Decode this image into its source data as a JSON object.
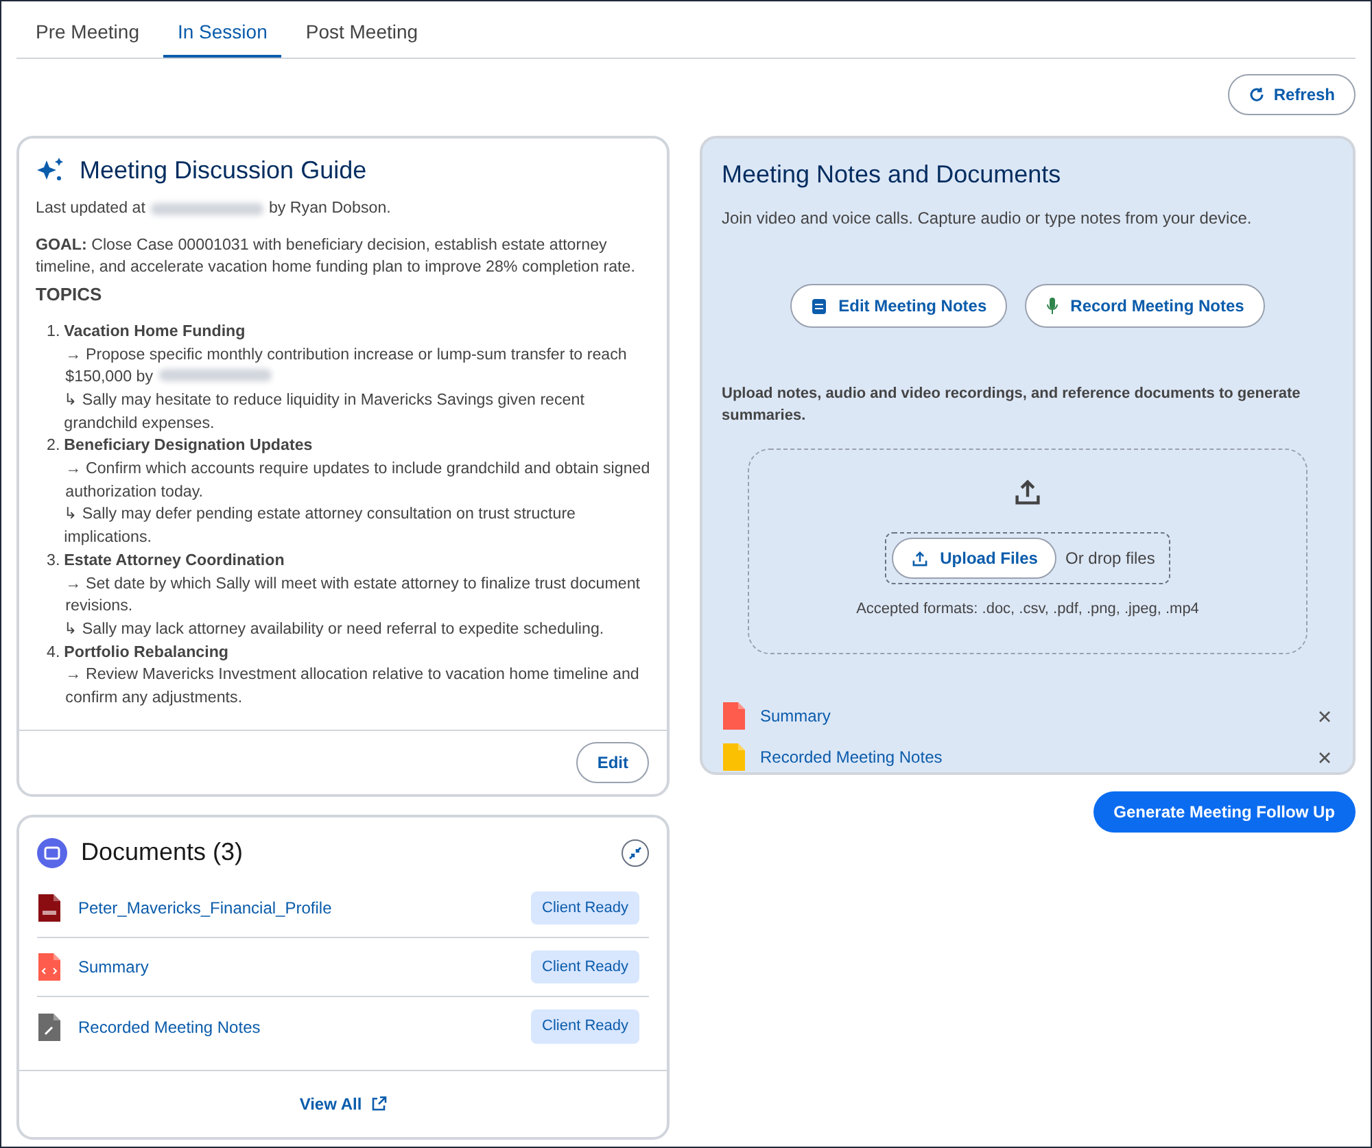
{
  "tabs": [
    {
      "label": "Pre Meeting",
      "selected": false
    },
    {
      "label": "In Session",
      "selected": true
    },
    {
      "label": "Post Meeting",
      "selected": false
    }
  ],
  "refresh_button": {
    "label": "Refresh"
  },
  "discussion_guide": {
    "title": "Meeting Discussion Guide",
    "updated_prefix": "Last updated at",
    "updated_suffix": "by Ryan Dobson.",
    "goal": "**GOAL:** Close Case 00001031 with beneficiary decision, establish estate attorney timeline, and accelerate vacation home funding plan to improve 28% completion rate.",
    "topics_heading": "TOPICS",
    "topics": [
      {
        "number": "1.",
        "title": "Vacation Home Funding",
        "action": "→ Propose specific monthly contribution increase or lump-sum transfer to reach $150,000 by",
        "action_redacted": true,
        "risk": "↳ Sally may hesitate to reduce liquidity in Mavericks Savings given recent grandchild expenses."
      },
      {
        "number": "2.",
        "title": "Beneficiary Designation Updates",
        "action": "→ Confirm which accounts require updates to include grandchild and obtain signed authorization today.",
        "action_redacted": false,
        "risk": "↳ Sally may defer pending estate attorney consultation on trust structure implications."
      },
      {
        "number": "3.",
        "title": "Estate Attorney Coordination",
        "action": "→ Set date by which Sally will meet with estate attorney to finalize trust document revisions.",
        "action_redacted": false,
        "risk": "↳ Sally may lack attorney availability or need referral to expedite scheduling."
      },
      {
        "number": "4.",
        "title": "Portfolio Rebalancing",
        "action": "→ Review Mavericks Investment allocation relative to vacation home timeline and confirm any adjustments.",
        "action_redacted": false
      }
    ],
    "edit_button": "Edit"
  },
  "documents": {
    "title": "Documents (3)",
    "items": [
      {
        "name": "Peter_Mavericks_Financial_Profile",
        "kind": "pdf",
        "status": "Client Ready"
      },
      {
        "name": "Summary",
        "kind": "code",
        "status": "Client Ready"
      },
      {
        "name": "Recorded Meeting Notes",
        "kind": "attachment",
        "status": "Client Ready"
      }
    ],
    "view_all": "View All"
  },
  "notes_panel": {
    "title": "Meeting Notes and Documents",
    "subtitle": "Join video and voice calls. Capture audio or type notes from your device.",
    "buttons": [
      {
        "label": "Edit Meeting Notes",
        "kind": "notes"
      },
      {
        "label": "Record Meeting Notes",
        "kind": "mic"
      }
    ],
    "upload_text": "Upload notes, audio and video recordings, and reference documents to generate summaries.",
    "upload_button": "Upload Files",
    "drop_text": "Or drop files",
    "formats": "Accepted formats: .doc, .csv, .pdf, .png, .jpeg, .mp4",
    "files": [
      {
        "name": "Summary",
        "color": "#fe5c4c"
      },
      {
        "name": "Recorded Meeting Notes",
        "color": "#fcc003"
      }
    ]
  },
  "generate_button": "Generate Meeting Follow Up"
}
